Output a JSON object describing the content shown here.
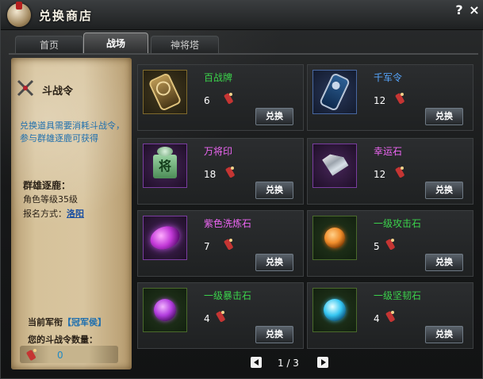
{
  "window": {
    "title": "兑换商店",
    "help": "?",
    "close": "×"
  },
  "tabs": [
    {
      "label": "首页",
      "active": false
    },
    {
      "label": "战场",
      "active": true
    },
    {
      "label": "神将塔",
      "active": false
    }
  ],
  "left_panel": {
    "title": "斗战令",
    "description": "兑换道具需要消耗斗战令，参与群雄逐鹿可获得",
    "event_title": "群雄逐鹿：",
    "requirement": "角色等级35级",
    "signup_label": "报名方式：",
    "signup_place": "洛阳",
    "rank_label": "当前军衔",
    "rank_value": "【冠军侯】",
    "token_label": "您的斗战令数量：",
    "token_count": "0"
  },
  "items": [
    {
      "name": "百战牌",
      "qty": "6",
      "button": "兑换",
      "name_color": "#3bd34b",
      "icon": "plaque-gold-icon"
    },
    {
      "name": "千军令",
      "qty": "12",
      "button": "兑换",
      "name_color": "#56a7ff",
      "icon": "plaque-blue-icon"
    },
    {
      "name": "万将印",
      "qty": "18",
      "button": "兑换",
      "name_color": "#ee66f4",
      "icon": "jade-seal-icon"
    },
    {
      "name": "幸运石",
      "qty": "12",
      "button": "兑换",
      "name_color": "#ee66f4",
      "icon": "diamond-icon"
    },
    {
      "name": "紫色洗炼石",
      "qty": "7",
      "button": "兑换",
      "name_color": "#ee66f4",
      "icon": "purple-oval-gem-icon"
    },
    {
      "name": "一级攻击石",
      "qty": "5",
      "button": "兑换",
      "name_color": "#3bd34b",
      "icon": "orange-gem-icon"
    },
    {
      "name": "一级暴击石",
      "qty": "4",
      "button": "兑换",
      "name_color": "#3bd34b",
      "icon": "purple-gem-icon"
    },
    {
      "name": "一级坚韧石",
      "qty": "4",
      "button": "兑换",
      "name_color": "#3bd34b",
      "icon": "blue-gem-icon"
    }
  ],
  "pagination": {
    "label": "1 / 3"
  }
}
